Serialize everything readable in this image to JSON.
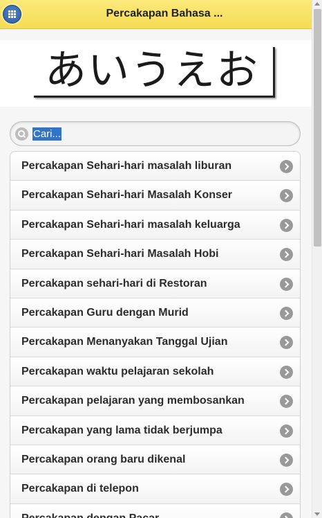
{
  "header": {
    "title": "Percakapan Bahasa ...",
    "menu_icon": "grid-menu-icon"
  },
  "banner": {
    "text": "あいうえお"
  },
  "search": {
    "placeholder": "Cari...",
    "icon": "search-icon"
  },
  "list": {
    "items": [
      {
        "label": "Percakapan Sehari-hari masalah liburan"
      },
      {
        "label": "Percakapan Sehari-hari Masalah Konser"
      },
      {
        "label": "Percakapan Sehari-hari masalah keluarga"
      },
      {
        "label": "Percakapan Sehari-hari Masalah Hobi"
      },
      {
        "label": "Percakapan sehari-hari di Restoran"
      },
      {
        "label": "Percakapan Guru dengan Murid"
      },
      {
        "label": "Percakapan Menanyakan Tanggal Ujian"
      },
      {
        "label": "Percakapan waktu pelajaran sekolah"
      },
      {
        "label": "Percakapan pelajaran yang membosankan"
      },
      {
        "label": "Percakapan yang lama tidak berjumpa"
      },
      {
        "label": "Percakapan orang baru dikenal"
      },
      {
        "label": "Percakapan di telepon"
      },
      {
        "label": "Percakapan dengan Pacar"
      }
    ],
    "item_icon": "chevron-right-icon"
  },
  "colors": {
    "header_bg": "#f5dc55",
    "menu_button": "#3a6fb3",
    "selection": "#3174c7"
  }
}
